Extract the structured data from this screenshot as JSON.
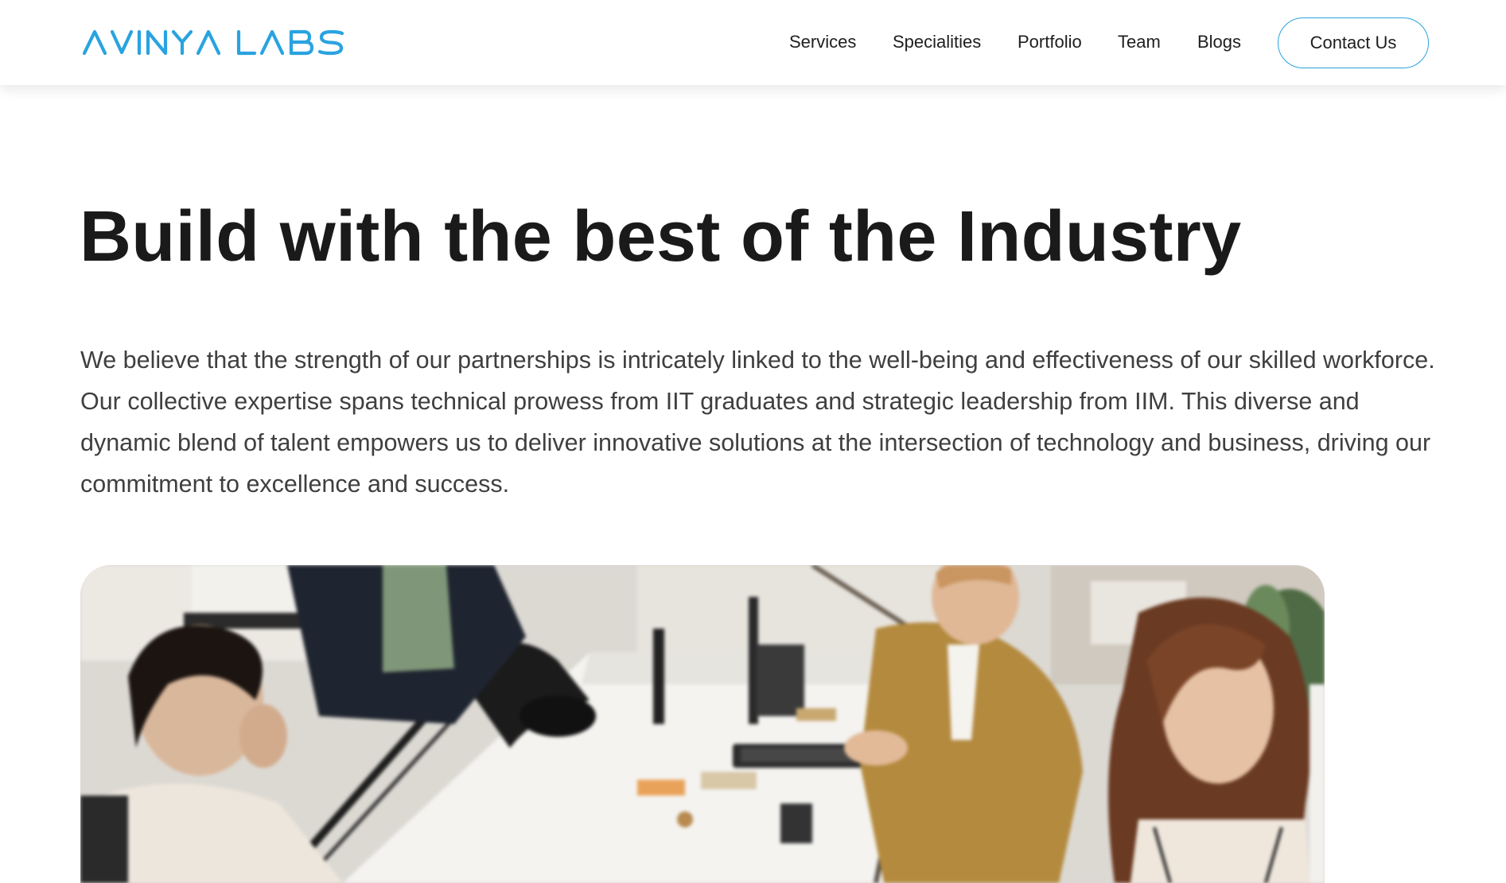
{
  "header": {
    "logo_text": "AVINYA LABS",
    "brand_color": "#29a3e0",
    "nav_items": [
      {
        "label": "Services"
      },
      {
        "label": "Specialities"
      },
      {
        "label": "Portfolio"
      },
      {
        "label": "Team"
      },
      {
        "label": "Blogs"
      }
    ],
    "contact_label": "Contact Us"
  },
  "hero": {
    "title": "Build with the best of the Industry",
    "description": "We believe that the strength of our partnerships is intricately linked to the well-being and effectiveness of our skilled workforce. Our collective expertise spans technical prowess from IIT graduates and strategic leadership from IIM. This diverse and dynamic blend of talent empowers us to deliver innovative solutions at the intersection of technology and business, driving our commitment to excellence and success."
  }
}
